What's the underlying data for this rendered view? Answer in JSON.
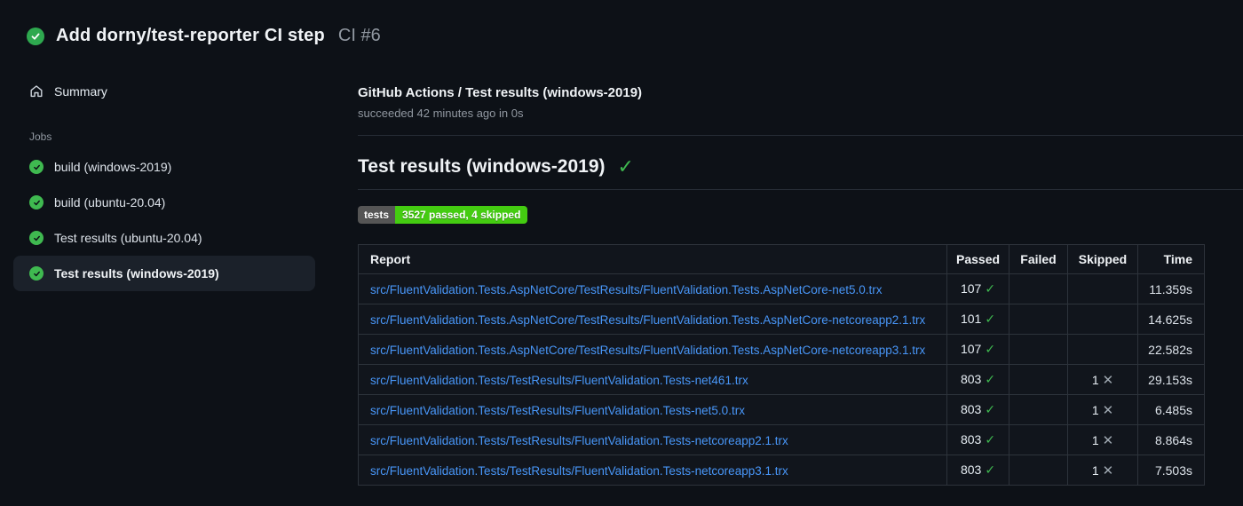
{
  "header": {
    "status_icon": "check-circle",
    "title": "Add dorny/test-reporter CI step",
    "run_label": "CI #6"
  },
  "sidebar": {
    "summary_label": "Summary",
    "jobs_label": "Jobs",
    "jobs": [
      {
        "label": "build (windows-2019)",
        "status": "success",
        "selected": false
      },
      {
        "label": "build (ubuntu-20.04)",
        "status": "success",
        "selected": false
      },
      {
        "label": "Test results (ubuntu-20.04)",
        "status": "success",
        "selected": false
      },
      {
        "label": "Test results (windows-2019)",
        "status": "success",
        "selected": true
      }
    ]
  },
  "main": {
    "breadcrumb": "GitHub Actions / Test results (windows-2019)",
    "status_line": "succeeded 42 minutes ago in 0s",
    "section_title": "Test results (windows-2019)",
    "section_status": "success",
    "badge": {
      "label": "tests",
      "value": "3527 passed, 4 skipped"
    },
    "table": {
      "headers": [
        "Report",
        "Passed",
        "Failed",
        "Skipped",
        "Time"
      ],
      "rows": [
        {
          "report": "src/FluentValidation.Tests.AspNetCore/TestResults/FluentValidation.Tests.AspNetCore-net5.0.trx",
          "passed": "107",
          "failed": "",
          "skipped": "",
          "time": "11.359s"
        },
        {
          "report": "src/FluentValidation.Tests.AspNetCore/TestResults/FluentValidation.Tests.AspNetCore-netcoreapp2.1.trx",
          "passed": "101",
          "failed": "",
          "skipped": "",
          "time": "14.625s"
        },
        {
          "report": "src/FluentValidation.Tests.AspNetCore/TestResults/FluentValidation.Tests.AspNetCore-netcoreapp3.1.trx",
          "passed": "107",
          "failed": "",
          "skipped": "",
          "time": "22.582s"
        },
        {
          "report": "src/FluentValidation.Tests/TestResults/FluentValidation.Tests-net461.trx",
          "passed": "803",
          "failed": "",
          "skipped": "1",
          "time": "29.153s"
        },
        {
          "report": "src/FluentValidation.Tests/TestResults/FluentValidation.Tests-net5.0.trx",
          "passed": "803",
          "failed": "",
          "skipped": "1",
          "time": "6.485s"
        },
        {
          "report": "src/FluentValidation.Tests/TestResults/FluentValidation.Tests-netcoreapp2.1.trx",
          "passed": "803",
          "failed": "",
          "skipped": "1",
          "time": "8.864s"
        },
        {
          "report": "src/FluentValidation.Tests/TestResults/FluentValidation.Tests-netcoreapp3.1.trx",
          "passed": "803",
          "failed": "",
          "skipped": "1",
          "time": "7.503s"
        }
      ]
    }
  },
  "colors": {
    "background": "#0d1117",
    "success_green": "#3fb950",
    "badge_green": "#44cc11",
    "badge_gray": "#555555",
    "link_blue": "#4896f8",
    "border": "#2d333b"
  }
}
